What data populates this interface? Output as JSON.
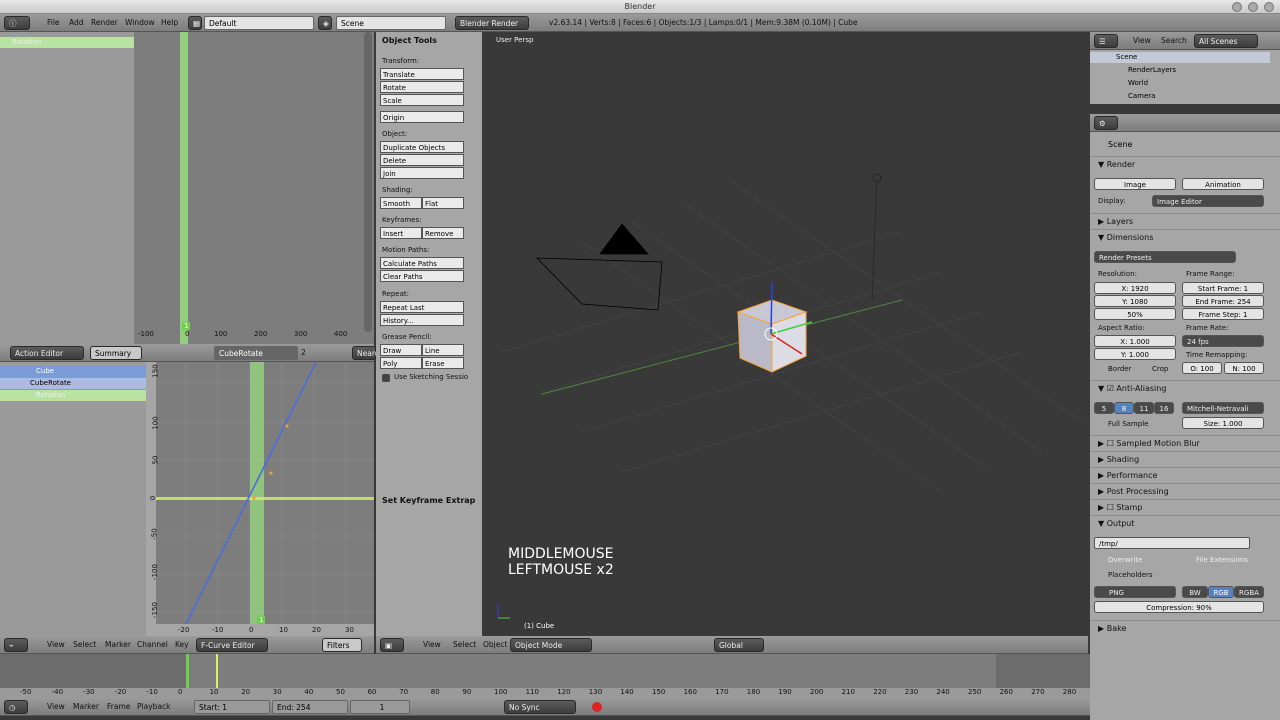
{
  "window": {
    "title": "Blender"
  },
  "info_header": {
    "menus": [
      "File",
      "Add",
      "Render",
      "Window",
      "Help"
    ],
    "screen_layout": "Default",
    "scene": "Scene",
    "engine": "Blender Render",
    "stats": "v2.63.14 | Verts:8 | Faces:6 | Objects:1/3 | Lamps:0/1 | Mem:9.38M (0.10M) | Cube"
  },
  "graph_top": {
    "channel": "Rotation",
    "ruler": [
      "-100",
      "0",
      "100",
      "200",
      "300",
      "400"
    ],
    "current_frame": "1"
  },
  "action_header": {
    "editor": "Action Editor",
    "mode": "Summary",
    "action": "CubeRotate",
    "users": "2",
    "nearest": "Neare"
  },
  "channels": {
    "object": "Cube",
    "action": "CubeRotate",
    "group": "Rotation"
  },
  "fcurve": {
    "y_ticks": [
      "150",
      "100",
      "50",
      "0",
      "-50",
      "-100",
      "-150"
    ],
    "x_ticks": [
      "-20",
      "-10",
      "0",
      "10",
      "20",
      "30"
    ],
    "current_frame": "1"
  },
  "fcurve_header": {
    "menus": [
      "View",
      "Select",
      "Marker",
      "Channel",
      "Key"
    ],
    "editor": "F-Curve Editor",
    "filters": "Filters"
  },
  "tools": {
    "title": "Object Tools",
    "transform_label": "Transform:",
    "translate": "Translate",
    "rotate": "Rotate",
    "scale": "Scale",
    "origin": "Origin",
    "object_label": "Object:",
    "duplicate": "Duplicate Objects",
    "delete": "Delete",
    "join": "Join",
    "shading_label": "Shading:",
    "smooth": "Smooth",
    "flat": "Flat",
    "keyframes_label": "Keyframes:",
    "insert": "Insert",
    "remove": "Remove",
    "motion_label": "Motion Paths:",
    "calc_paths": "Calculate Paths",
    "clear_paths": "Clear Paths",
    "repeat_label": "Repeat:",
    "repeat_last": "Repeat Last",
    "history": "History...",
    "grease_label": "Grease Pencil:",
    "draw": "Draw",
    "line": "Line",
    "poly": "Poly",
    "erase": "Erase",
    "sketch": "Use Sketching Sessio",
    "operator": "Set Keyframe Extrap"
  },
  "viewport": {
    "view_name": "User Persp",
    "key_line1": "MIDDLEMOUSE",
    "key_line2": "LEFTMOUSE x2",
    "object_label": "(1) Cube"
  },
  "view3d_header": {
    "menus": [
      "View",
      "Select",
      "Object"
    ],
    "mode": "Object Mode",
    "orientation": "Global"
  },
  "timeline": {
    "ruler": [
      "-50",
      "-40",
      "-30",
      "-20",
      "-10",
      "0",
      "10",
      "20",
      "30",
      "40",
      "50",
      "60",
      "70",
      "80",
      "90",
      "100",
      "110",
      "120",
      "130",
      "140",
      "150",
      "160",
      "170",
      "180",
      "190",
      "200",
      "210",
      "220",
      "230",
      "240",
      "250",
      "260",
      "270",
      "280"
    ],
    "menus": [
      "View",
      "Marker",
      "Frame",
      "Playback"
    ],
    "start": "Start: 1",
    "end": "End: 254",
    "current": "1",
    "sync": "No Sync"
  },
  "outliner": {
    "menus": [
      "View",
      "Search"
    ],
    "filter": "All Scenes",
    "items": [
      "Scene",
      "RenderLayers",
      "World",
      "Camera"
    ]
  },
  "properties": {
    "context": "Scene",
    "render": "Render",
    "image": "Image",
    "animation": "Animation",
    "display_label": "Display:",
    "display": "Image Editor",
    "layers": "Layers",
    "dimensions": "Dimensions",
    "presets": "Render Presets",
    "resolution": "Resolution:",
    "res_x": "X: 1920",
    "res_y": "Y: 1080",
    "res_pct": "50%",
    "frame_range": "Frame Range:",
    "start_frame": "Start Frame: 1",
    "end_frame": "End Frame: 254",
    "frame_step": "Frame Step: 1",
    "aspect": "Aspect Ratio:",
    "asp_x": "X: 1.000",
    "asp_y": "Y: 1.000",
    "frame_rate": "Frame Rate:",
    "fps": "24 fps",
    "time_remap": "Time Remapping:",
    "remap_old": "O: 100",
    "remap_new": "N: 100",
    "border": "Border",
    "crop": "Crop",
    "aa": "Anti-Aliasing",
    "aa_levels": [
      "5",
      "8",
      "11",
      "16"
    ],
    "filter": "Mitchell-Netravali",
    "full_sample": "Full Sample",
    "size": "Size: 1.000",
    "motion_blur": "Sampled Motion Blur",
    "shading": "Shading",
    "performance": "Performance",
    "post": "Post Processing",
    "stamp": "Stamp",
    "output": "Output",
    "path": "/tmp/",
    "overwrite": "Overwrite",
    "extensions": "File Extensions",
    "placeholders": "Placeholders",
    "format": "PNG",
    "bw": "BW",
    "rgb": "RGB",
    "rgba": "RGBA",
    "compression": "Compression: 90%",
    "bake": "Bake"
  }
}
